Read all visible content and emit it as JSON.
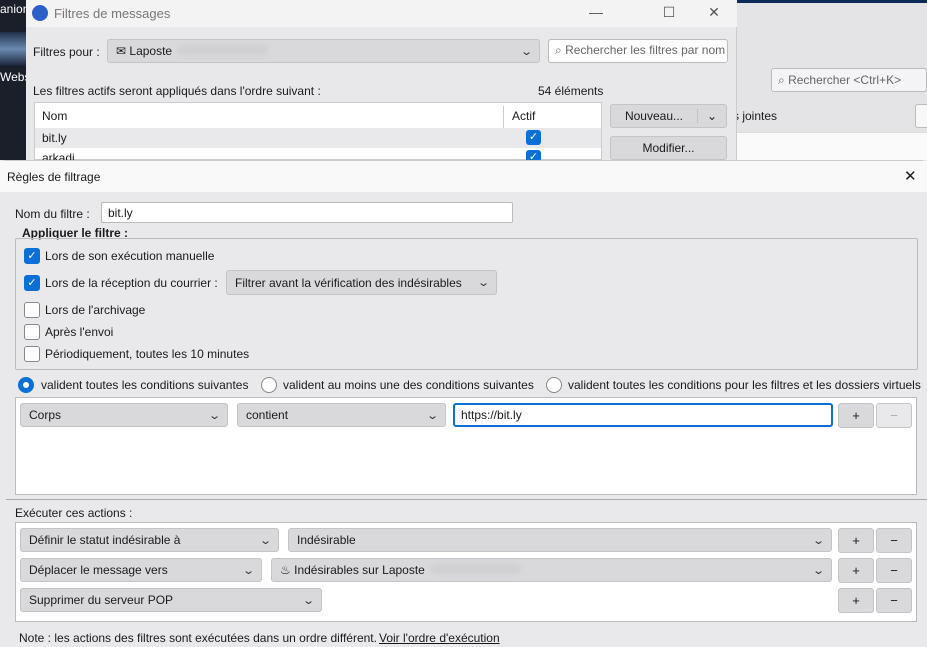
{
  "background": {
    "left_text_top": "anion",
    "left_text_bottom": "Webs",
    "search_placeholder": "Rechercher <Ctrl+K>",
    "partial_label": "s jointes"
  },
  "filter_list": {
    "title": "Filtres de messages",
    "filters_for_label": "Filtres pour :",
    "account": "Laposte",
    "search_placeholder": "Rechercher les filtres par nom",
    "order_text": "Les filtres actifs seront appliqués dans l'ordre suivant :",
    "count": "54 éléments",
    "columns": [
      "Nom",
      "Actif"
    ],
    "rows": [
      {
        "name": "bit.ly",
        "active": true
      },
      {
        "name": "arkadi",
        "active": true
      }
    ],
    "new_button": "Nouveau...",
    "edit_button": "Modifier..."
  },
  "rules": {
    "title": "Règles de filtrage",
    "name_label": "Nom du filtre :",
    "name_value": "bit.ly",
    "apply_label": "Appliquer le filtre :",
    "options": [
      {
        "label": "Lors de son exécution manuelle",
        "checked": true
      },
      {
        "label": "Lors de la réception du courrier :",
        "checked": true
      },
      {
        "label": "Lors de l'archivage",
        "checked": false
      },
      {
        "label": "Après l'envoi",
        "checked": false
      },
      {
        "label": "Périodiquement, toutes les 10 minutes",
        "checked": false
      }
    ],
    "reception_select": "Filtrer avant la vérification des indésirables",
    "match": [
      {
        "label": "valident toutes les conditions suivantes",
        "selected": true
      },
      {
        "label": "valident au moins une des conditions suivantes",
        "selected": false
      },
      {
        "label": "valident toutes les conditions pour les filtres et les dossiers virtuels",
        "selected": false
      }
    ],
    "condition": {
      "field": "Corps",
      "operator": "contient",
      "value": "https://bit.ly"
    },
    "actions_label": "Exécuter ces actions :",
    "actions": [
      {
        "action": "Définir le statut indésirable à",
        "value": "Indésirable"
      },
      {
        "action": "Déplacer le message vers",
        "value": "Indésirables sur Laposte"
      },
      {
        "action": "Supprimer du serveur POP"
      }
    ],
    "plus": "+",
    "minus": "−",
    "note": "Note : les actions des filtres sont exécutées dans un ordre différent.",
    "note_link": "Voir l'ordre d'exécution"
  }
}
